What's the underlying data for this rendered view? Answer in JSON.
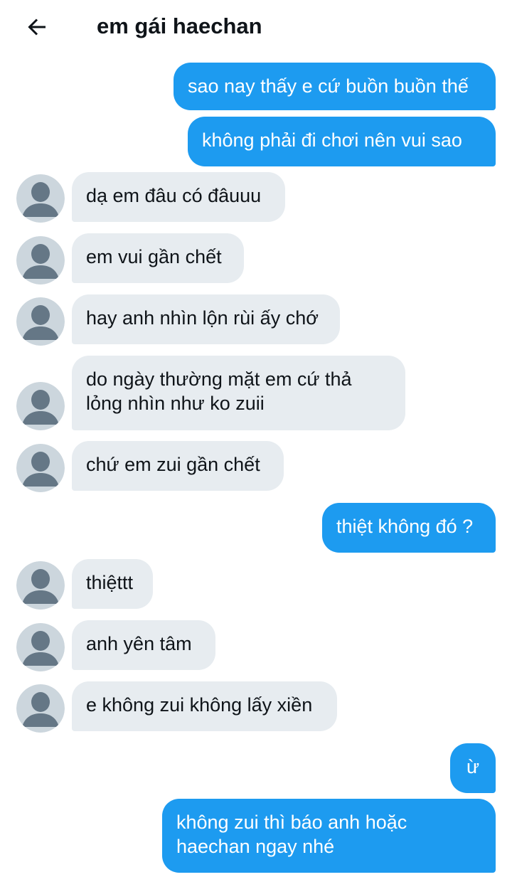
{
  "header": {
    "title": "em gái haechan",
    "back_icon": "arrow-left-icon"
  },
  "messages": [
    {
      "side": "out",
      "text": "sao nay thấy e cứ buồn buồn thế"
    },
    {
      "side": "out",
      "text": "không phải đi chơi nên vui sao"
    },
    {
      "side": "in",
      "text": "dạ em đâu có đâuuu"
    },
    {
      "side": "in",
      "text": "em vui gần chết"
    },
    {
      "side": "in",
      "text": "hay anh nhìn lộn rùi ấy chớ"
    },
    {
      "side": "in",
      "text": "do ngày thường mặt em cứ thả\nlỏng nhìn như ko zuii"
    },
    {
      "side": "in",
      "text": "chứ em zui gần chết"
    },
    {
      "side": "out",
      "text": "thiệt không đó ?"
    },
    {
      "side": "in",
      "text": "thiệttt"
    },
    {
      "side": "in",
      "text": "anh yên tâm"
    },
    {
      "side": "in",
      "text": "e không zui không lấy xiền"
    },
    {
      "side": "out",
      "text": "ừ"
    },
    {
      "side": "out",
      "text": "không zui thì báo anh hoặc\nhaechan ngay nhé"
    }
  ],
  "colors": {
    "outgoing_bubble": "#1d9bf0",
    "incoming_bubble": "#e7ecf0",
    "avatar_bg": "#ccd6dd",
    "avatar_figure": "#657786"
  }
}
